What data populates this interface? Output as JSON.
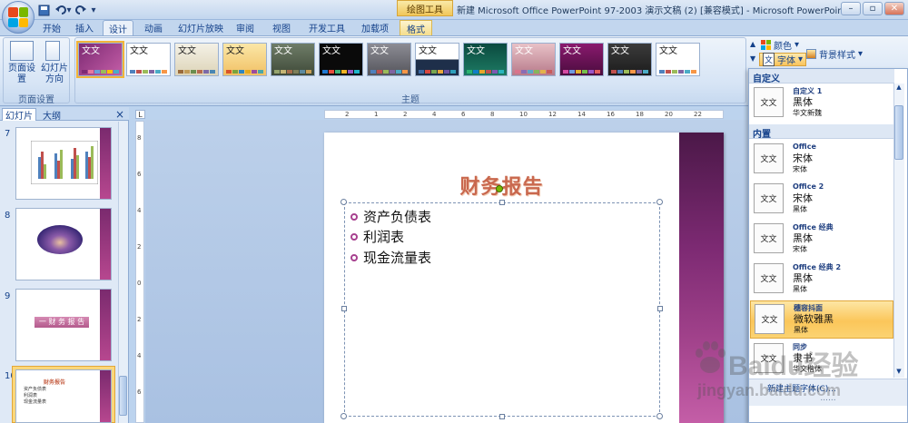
{
  "titlebar": {
    "title": "新建 Microsoft Office PowerPoint 97-2003 演示文稿 (2) [兼容模式] - Microsoft PowerPoint",
    "context_tool_label": "绘图工具",
    "quick_access": [
      "save-icon",
      "undo-icon",
      "redo-icon",
      "customize-icon"
    ],
    "window_buttons": [
      "minimize-icon",
      "maximize-icon",
      "close-icon"
    ]
  },
  "tabs": {
    "items": [
      "开始",
      "插入",
      "设计",
      "动画",
      "幻灯片放映",
      "审阅",
      "视图",
      "开发工具",
      "加载项",
      "格式"
    ],
    "active": "设计"
  },
  "ribbon": {
    "page_setup": {
      "setup_label": "页面设置",
      "orientation_label_1": "幻灯片",
      "orientation_label_2": "方向",
      "group_label": "页面设置"
    },
    "themes_group_label": "主题",
    "theme_sample": "文文",
    "colors_label": "颜色",
    "fonts_label": "字体",
    "background_styles_label": "背景样式"
  },
  "left_pane": {
    "tabs": [
      "幻灯片",
      "大纲"
    ],
    "close_label": "×",
    "slide_numbers": [
      "7",
      "8",
      "9",
      "10"
    ],
    "thumb9_title": "一  财  务  报  告",
    "thumb10_title": "财务报告",
    "thumb10_items": [
      "资产负债表",
      "利润表",
      "现金流量表"
    ]
  },
  "ruler": {
    "corner_label": "L",
    "h_numbers": [
      "2",
      "1",
      "2",
      "4",
      "6",
      "8",
      "10",
      "12",
      "14",
      "16",
      "18",
      "20",
      "22"
    ],
    "v_numbers": [
      "8",
      "6",
      "4",
      "2",
      "0",
      "2",
      "4",
      "6"
    ]
  },
  "slide": {
    "title": "财务报告",
    "bullets": [
      "资产负债表",
      "利润表",
      "现金流量表"
    ]
  },
  "fonts_dropdown": {
    "custom_header": "自定义",
    "builtin_header": "内置",
    "sample_icon_text": "文文",
    "items": [
      {
        "name": "自定义 1",
        "major": "黑体",
        "minor": "华文新魏"
      },
      {
        "name": "Office",
        "major": "宋体",
        "minor": "宋体"
      },
      {
        "name": "Office 2",
        "major": "宋体",
        "minor": "黑体"
      },
      {
        "name": "Office 经典",
        "major": "黑体",
        "minor": "宋体"
      },
      {
        "name": "Office 经典 2",
        "major": "黑体",
        "minor": "黑体"
      },
      {
        "name": "穗容抖面",
        "major": "微软雅黑",
        "minor": "黑体"
      },
      {
        "name": "同步",
        "major": "隶书",
        "minor": "华文楷体"
      }
    ],
    "selected_index": 5,
    "footer_label": "新建主题字体(C)...",
    "footer_dots": "......"
  },
  "watermark": {
    "brand": "Baidu经验",
    "url": "jingyan.baidu.com"
  },
  "colors": {
    "ribbon_text": "#15428b",
    "slide_accent": "#7d2a73",
    "selected_highlight": "#fbc65a",
    "title_color": "#c9684e"
  }
}
